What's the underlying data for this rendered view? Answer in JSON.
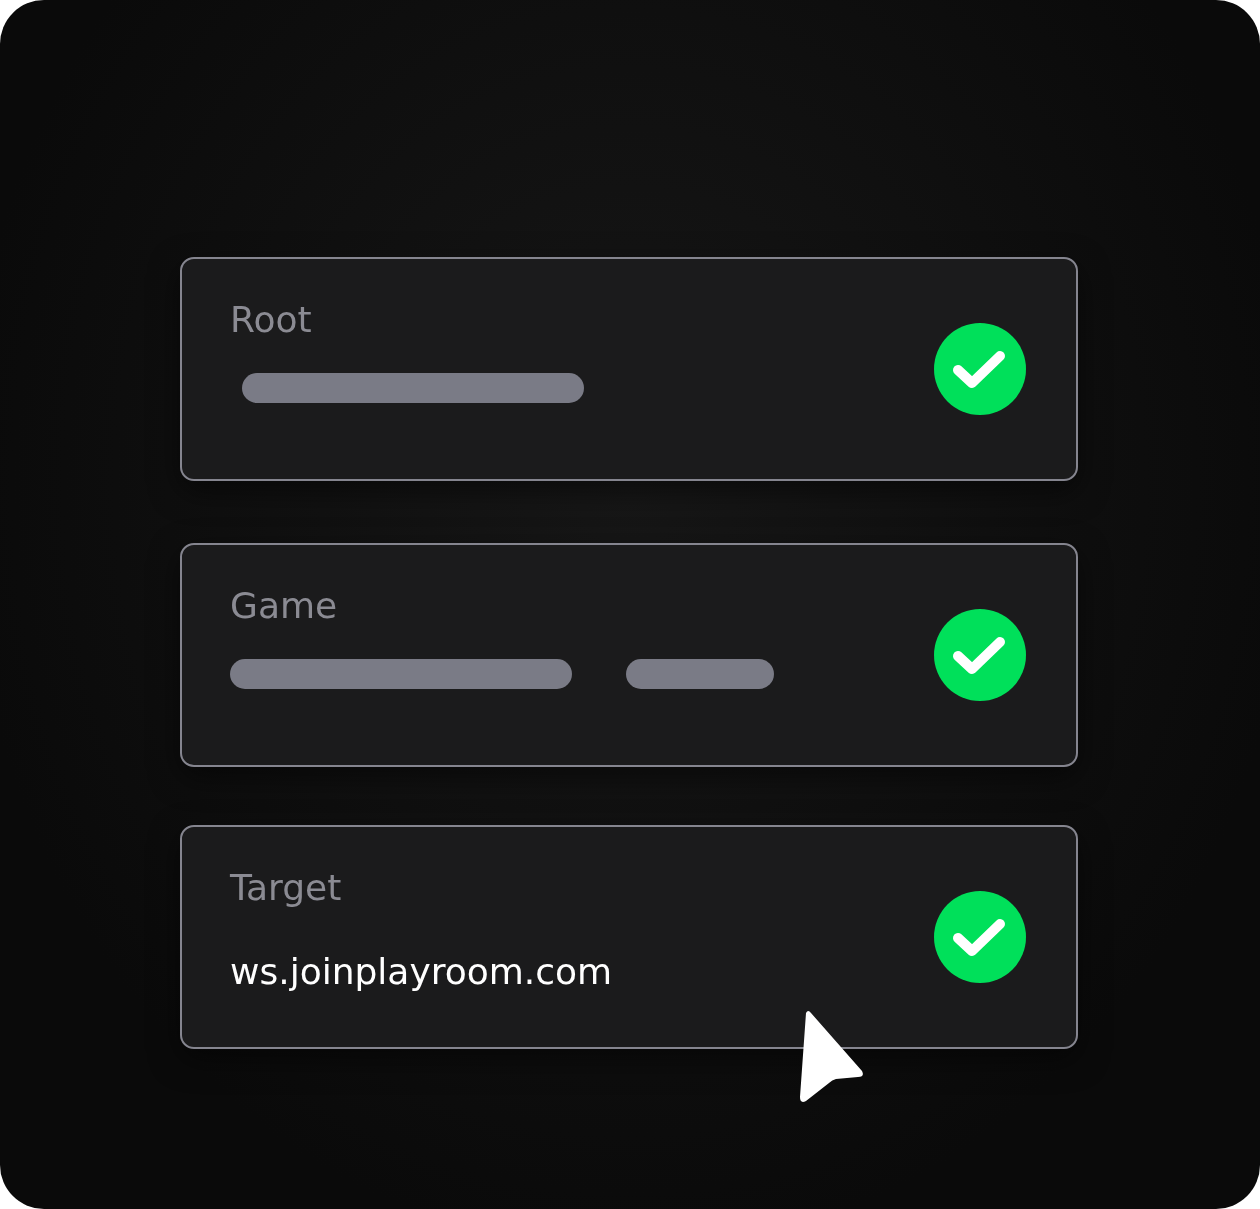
{
  "fields": [
    {
      "label": "Root",
      "kind": "placeholder",
      "bars": [
        {
          "kind": "long"
        }
      ],
      "verified": true
    },
    {
      "label": "Game",
      "kind": "placeholder",
      "bars": [
        {
          "kind": "long"
        },
        {
          "kind": "short"
        }
      ],
      "verified": true
    },
    {
      "label": "Target",
      "kind": "value",
      "value": "ws.joinplayroom.com",
      "verified": true
    }
  ],
  "cursor": true
}
